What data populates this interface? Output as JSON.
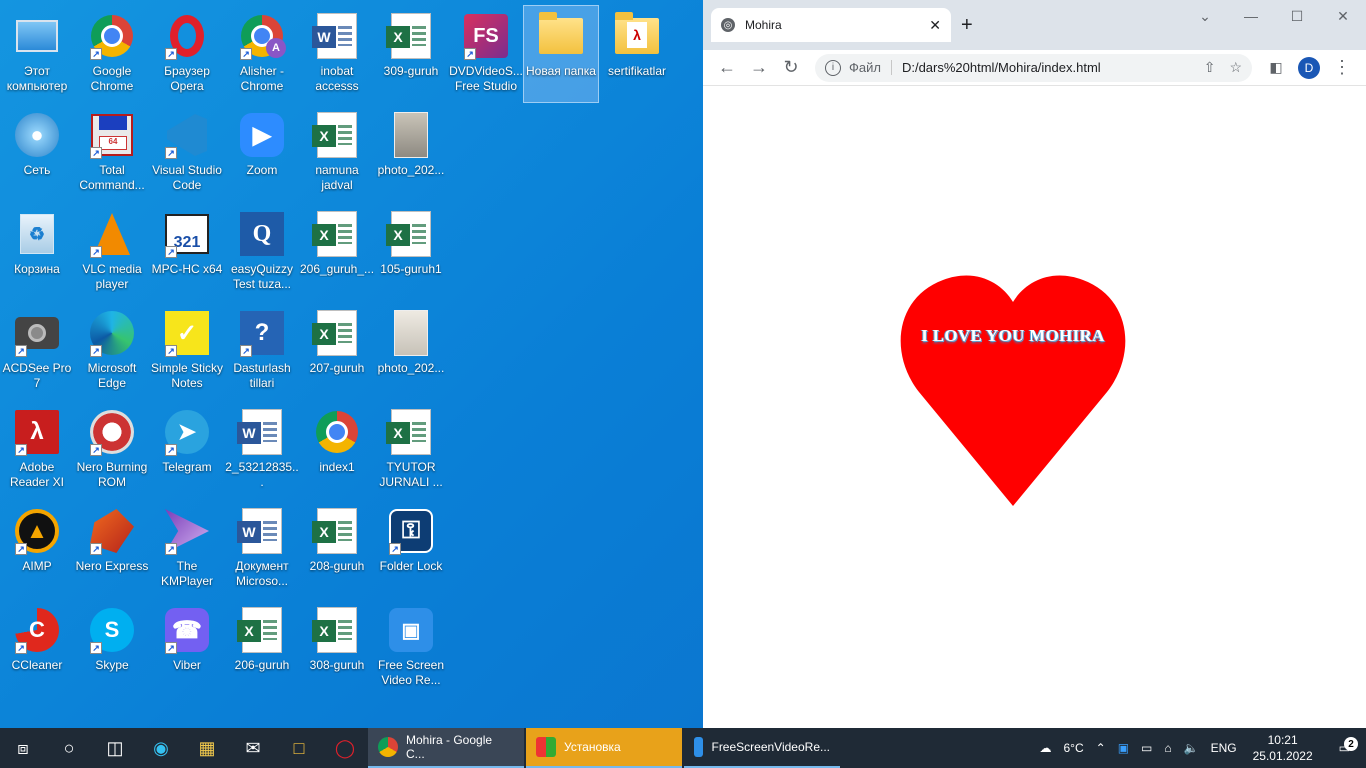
{
  "desktop": {
    "icons": [
      {
        "label": "Этот компьютер"
      },
      {
        "label": "Google Chrome"
      },
      {
        "label": "Браузер Opera"
      },
      {
        "label": "Alisher - Chrome"
      },
      {
        "label": "inobat accesss"
      },
      {
        "label": "309-guruh"
      },
      {
        "label": "DVDVideoS... Free Studio"
      },
      {
        "label": "Новая папка"
      },
      {
        "label": "sertifikatlar"
      },
      {
        "label": "Сеть"
      },
      {
        "label": "Total Command..."
      },
      {
        "label": "Visual Studio Code"
      },
      {
        "label": "Zoom"
      },
      {
        "label": "namuna jadval"
      },
      {
        "label": "photo_202..."
      },
      {
        "label": "Корзина"
      },
      {
        "label": "VLC media player"
      },
      {
        "label": "MPC-HC x64"
      },
      {
        "label": "easyQuizzy Test tuza..."
      },
      {
        "label": "206_guruh_..."
      },
      {
        "label": "105-guruh1"
      },
      {
        "label": "ACDSee Pro 7"
      },
      {
        "label": "Microsoft Edge"
      },
      {
        "label": "Simple Sticky Notes"
      },
      {
        "label": "Dasturlash tillari"
      },
      {
        "label": "207-guruh"
      },
      {
        "label": "photo_202..."
      },
      {
        "label": "Adobe Reader XI"
      },
      {
        "label": "Nero Burning ROM"
      },
      {
        "label": "Telegram"
      },
      {
        "label": "2_53212835..."
      },
      {
        "label": "index1"
      },
      {
        "label": "TYUTOR JURNALI ..."
      },
      {
        "label": "AIMP"
      },
      {
        "label": "Nero Express"
      },
      {
        "label": "The KMPlayer"
      },
      {
        "label": "Документ Microso..."
      },
      {
        "label": "208-guruh"
      },
      {
        "label": "Folder Lock"
      },
      {
        "label": "CCleaner"
      },
      {
        "label": "Skype"
      },
      {
        "label": "Viber"
      },
      {
        "label": "206-guruh"
      },
      {
        "label": "308-guruh"
      },
      {
        "label": "Free Screen Video Re..."
      }
    ]
  },
  "browser": {
    "tab_title": "Mohira",
    "address_scheme": "Файл",
    "address_url": "D:/dars%20html/Mohira/index.html",
    "profile_initial": "D",
    "page": {
      "heart_text": "I LOVE YOU MOHIRA",
      "heart_color": "#ff0000"
    }
  },
  "taskbar": {
    "apps": [
      {
        "label": "Mohira - Google C..."
      },
      {
        "label": "Установка"
      },
      {
        "label": "FreeScreenVideoRe..."
      }
    ],
    "weather": "6°C",
    "language": "ENG",
    "time": "10:21",
    "date": "25.01.2022",
    "notifications": "2"
  }
}
